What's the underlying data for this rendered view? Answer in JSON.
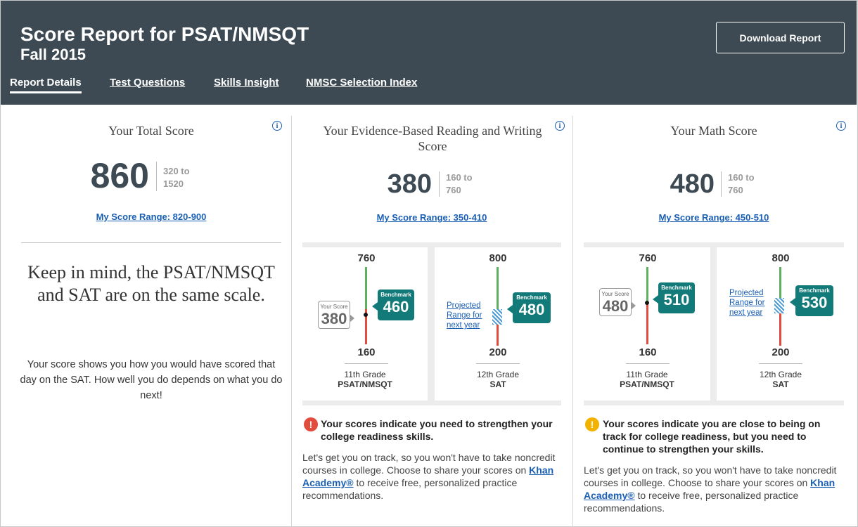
{
  "header": {
    "title": "Score Report for PSAT/NMSQT",
    "subtitle": "Fall 2015",
    "download_label": "Download Report",
    "tabs": [
      {
        "label": "Report Details",
        "active": true
      },
      {
        "label": "Test Questions",
        "active": false
      },
      {
        "label": "Skills Insight",
        "active": false
      },
      {
        "label": "NMSC Selection Index",
        "active": false
      }
    ]
  },
  "total": {
    "title": "Your Total Score",
    "score": "860",
    "range_low": "320 to",
    "range_high": "1520",
    "my_range": "My Score Range: 820-900",
    "keep_in_mind": "Keep in mind, the PSAT/NMSQT and SAT are on the same scale.",
    "explain": "Your score shows you how you would have scored that day on the SAT. How well you do depends on what you do next!"
  },
  "ebrw": {
    "title": "Your Evidence-Based Reading and Writing Score",
    "score": "380",
    "range_low": "160 to",
    "range_high": "760",
    "my_range": "My Score Range: 350-410",
    "g1": {
      "top": "760",
      "bottom": "160",
      "your_label": "Your Score",
      "your_value": "380",
      "bench_label": "Benchmark",
      "bench_value": "460",
      "grade": "11th Grade",
      "test": "PSAT/NMSQT"
    },
    "g2": {
      "top": "800",
      "bottom": "200",
      "proj_line1": "Projected",
      "proj_line2": "Range for",
      "proj_line3": "next year",
      "bench_label": "Benchmark",
      "bench_value": "480",
      "grade": "12th Grade",
      "test": "SAT"
    },
    "msg_head": "Your scores indicate you need to strengthen your college readiness skills.",
    "msg_pre": "Let's get you on track, so you won't have to take noncredit courses in college. Choose to share your scores on ",
    "msg_link": "Khan Academy®",
    "msg_post": " to receive free, personalized practice recommendations."
  },
  "math": {
    "title": "Your Math Score",
    "score": "480",
    "range_low": "160 to",
    "range_high": "760",
    "my_range": "My Score Range: 450-510",
    "g1": {
      "top": "760",
      "bottom": "160",
      "your_label": "Your Score",
      "your_value": "480",
      "bench_label": "Benchmark",
      "bench_value": "510",
      "grade": "11th Grade",
      "test": "PSAT/NMSQT"
    },
    "g2": {
      "top": "800",
      "bottom": "200",
      "proj_line1": "Projected",
      "proj_line2": "Range for",
      "proj_line3": "next year",
      "bench_label": "Benchmark",
      "bench_value": "530",
      "grade": "12th Grade",
      "test": "SAT"
    },
    "msg_head": "Your scores indicate you are close to being on track for college readiness, but you need to continue to strengthen your skills.",
    "msg_pre": "Let's get you on track, so you won't have to take noncredit courses in college. Choose to share your scores on ",
    "msg_link": "Khan Academy®",
    "msg_post": " to receive free, personalized practice recommendations."
  },
  "colors": {
    "header_bg": "#3d4a53",
    "benchmark": "#127a78",
    "below": "#e24c3c",
    "above": "#5db05f",
    "warn": "#f3b200",
    "link": "#1a5fb4"
  }
}
